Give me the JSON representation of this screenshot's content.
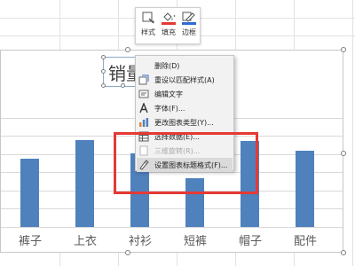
{
  "toolbar": {
    "style_label": "样式",
    "fill_label": "填充",
    "border_label": "边框",
    "fill_color": "#e53935",
    "border_color": "#2f6bd1",
    "style_icon": "chart-style-icon",
    "fill_icon": "paint-bucket-icon",
    "border_icon": "pen-outline-icon"
  },
  "chart": {
    "title": "销量",
    "bar_color": "#4f81bd",
    "categories": [
      "裤子",
      "上衣",
      "衬衫",
      "短裤",
      "帽子",
      "配件"
    ]
  },
  "chart_data": {
    "type": "bar",
    "title": "销量",
    "categories": [
      "裤子",
      "上衣",
      "衬衫",
      "短裤",
      "帽子",
      "配件"
    ],
    "values": [
      0.56,
      0.71,
      0.6,
      0.4,
      0.7,
      0.62
    ],
    "grid": true,
    "legend": "none"
  },
  "context_menu": {
    "items": [
      {
        "label": "删除(D)",
        "icon": "delete-icon",
        "disabled": false
      },
      {
        "label": "重设以匹配样式(A)",
        "icon": "reset-style-icon",
        "disabled": false
      },
      {
        "label": "编辑文字",
        "icon": "edit-text-icon",
        "disabled": false
      },
      {
        "label": "字体(F)...",
        "icon": "font-icon",
        "disabled": false
      },
      {
        "label": "更改图表类型(Y)...",
        "icon": "chart-type-icon",
        "disabled": false
      },
      {
        "label": "选择数据(E)...",
        "icon": "select-data-icon",
        "disabled": false
      },
      {
        "label": "三维旋转(R)...",
        "icon": "3d-rotation-icon",
        "disabled": true
      },
      {
        "label": "设置图表标题格式(F)...",
        "icon": "format-title-icon",
        "disabled": false,
        "highlighted": true
      }
    ]
  },
  "annotation": {
    "color": "#e53935"
  }
}
